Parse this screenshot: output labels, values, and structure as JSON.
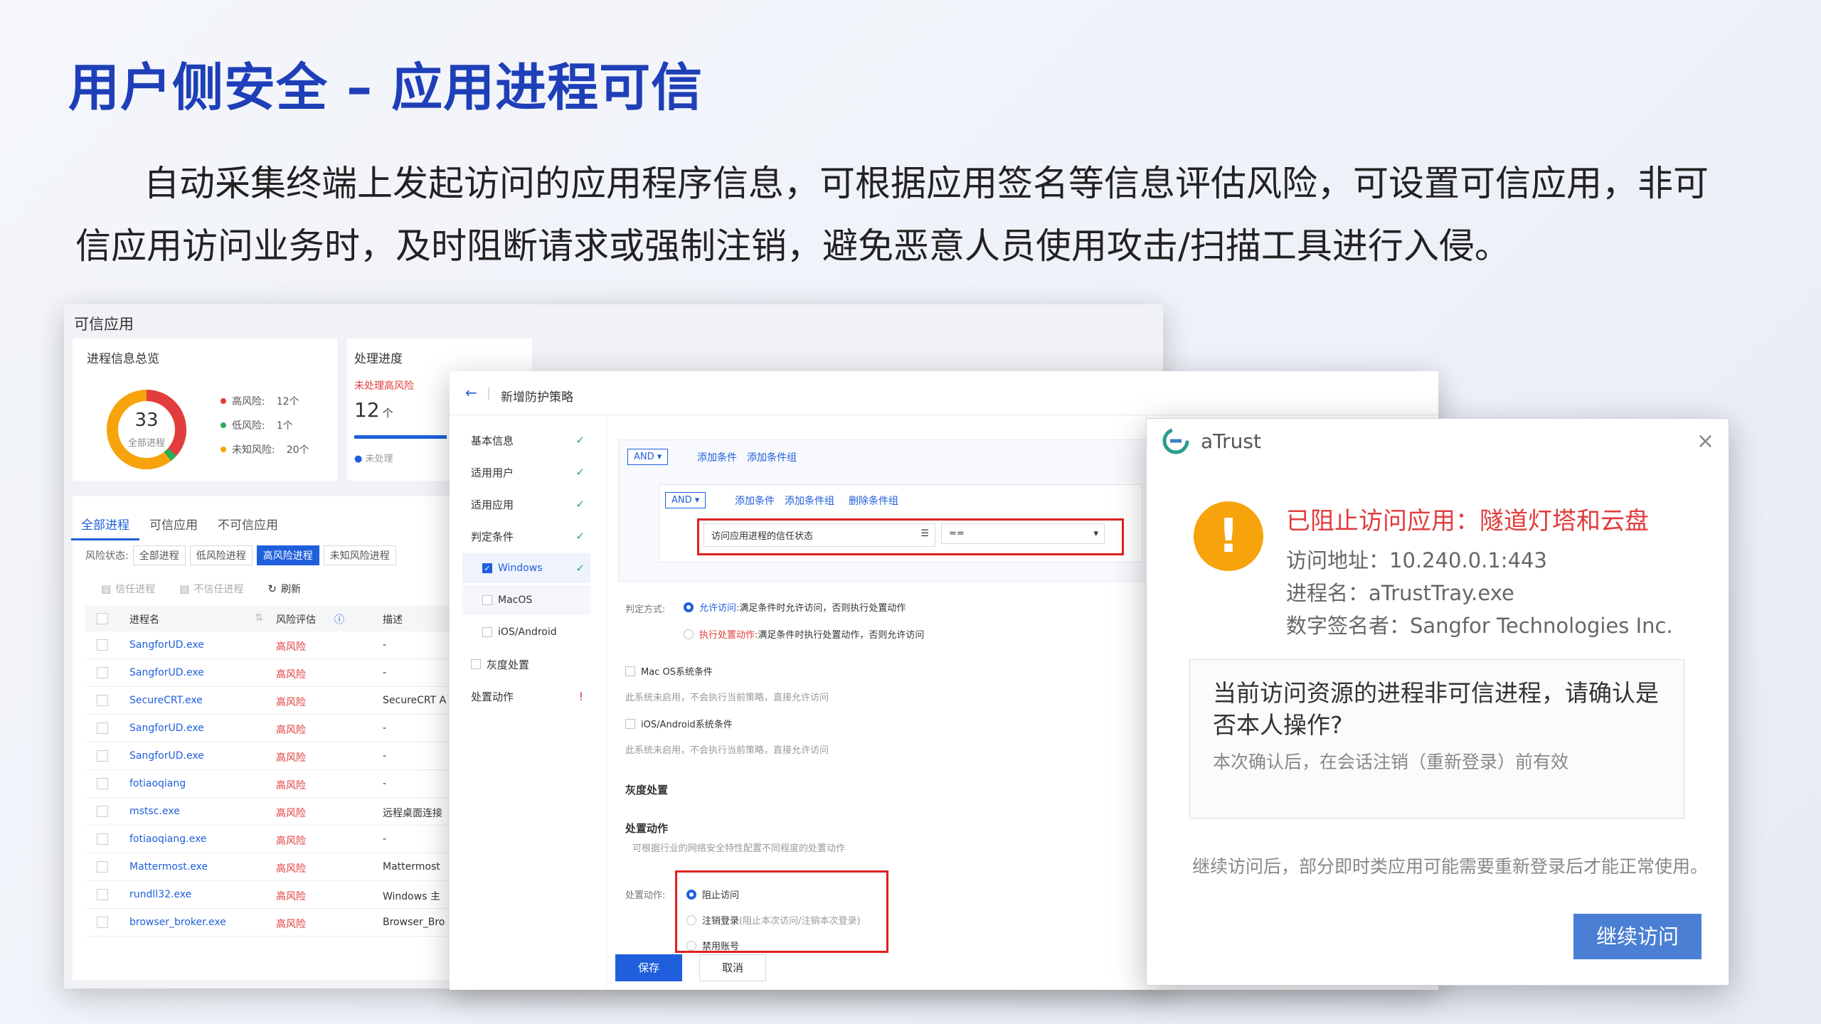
{
  "slide": {
    "title": "用户侧安全 – 应用进程可信",
    "desc": "自动采集终端上发起访问的应用程序信息，可根据应用签名等信息评估风险，可设置可信应用，非可信应用访问业务时，及时阻断请求或强制注销，避免恶意人员使用攻击/扫描工具进行入侵。"
  },
  "trusted_window": {
    "title": "可信应用",
    "overview": {
      "title": "进程信息总览",
      "total": "33",
      "total_label": "全部进程",
      "legend": [
        {
          "label": "高风险:",
          "value": "12个",
          "color": "#e23c3c"
        },
        {
          "label": "低风险:",
          "value": "1个",
          "color": "#2eaa5c"
        },
        {
          "label": "未知风险:",
          "value": "20个",
          "color": "#f7a30c"
        }
      ]
    },
    "progress": {
      "title": "处理进度",
      "unhandled_high_label": "未处理高风险",
      "count": "12",
      "unit": "个",
      "unhandled": "未处理"
    },
    "tabs": [
      "全部进程",
      "可信应用",
      "不可信应用"
    ],
    "filter_label": "风险状态:",
    "filters": [
      "全部进程",
      "低风险进程",
      "高风险进程",
      "未知风险进程"
    ],
    "actions": {
      "trust": "信任进程",
      "untrust": "不信任进程",
      "refresh": "刷新"
    },
    "columns": [
      "进程名",
      "风险评估",
      "描述"
    ],
    "rows": [
      {
        "name": "SangforUD.exe",
        "risk": "高风险",
        "desc": "-"
      },
      {
        "name": "SangforUD.exe",
        "risk": "高风险",
        "desc": "-"
      },
      {
        "name": "SecureCRT.exe",
        "risk": "高风险",
        "desc": "SecureCRT A"
      },
      {
        "name": "SangforUD.exe",
        "risk": "高风险",
        "desc": "-"
      },
      {
        "name": "SangforUD.exe",
        "risk": "高风险",
        "desc": "-"
      },
      {
        "name": "fotiaoqiang",
        "risk": "高风险",
        "desc": "-"
      },
      {
        "name": "mstsc.exe",
        "risk": "高风险",
        "desc": "远程桌面连接"
      },
      {
        "name": "fotiaoqiang.exe",
        "risk": "高风险",
        "desc": "-"
      },
      {
        "name": "Mattermost.exe",
        "risk": "高风险",
        "desc": "Mattermost"
      },
      {
        "name": "rundll32.exe",
        "risk": "高风险",
        "desc": "Windows 主"
      },
      {
        "name": "browser_broker.exe",
        "risk": "高风险",
        "desc": "Browser_Bro"
      }
    ]
  },
  "policy_window": {
    "title": "新增防护策略",
    "side": {
      "basic": "基本信息",
      "users": "适用用户",
      "apps": "适用应用",
      "conditions": "判定条件",
      "windows": "Windows",
      "macos": "MacOS",
      "ios": "iOS/Android",
      "gray": "灰度处置",
      "action": "处置动作"
    },
    "cond": {
      "and": "AND",
      "add_cond": "添加条件",
      "add_group": "添加条件组",
      "del_group": "删除条件组",
      "field": "访问应用进程的信任状态",
      "op": "=="
    },
    "judge_label": "判定方式:",
    "judge_allow": "允许访问:",
    "judge_allow_desc": "满足条件时允许访问，否则执行处置动作",
    "judge_exec": "执行处置动作:",
    "judge_exec_desc": "满足条件时执行处置动作，否则允许访问",
    "mac_cond": "Mac OS系统条件",
    "mac_hint": "此系统未启用，不会执行当前策略，直接允许访问",
    "ios_cond": "iOS/Android系统条件",
    "ios_hint": "此系统未启用，不会执行当前策略，直接允许访问",
    "gray_title": "灰度处置",
    "action_title": "处置动作",
    "action_hint": "可根据行业的网络安全特性配置不同程度的处置动作",
    "action_label": "处置动作:",
    "opt_block": "阻止访问",
    "opt_logout": "注销登录",
    "opt_logout_note": "(阻止本次访问/注销本次登录)",
    "opt_disable": "禁用账号",
    "save": "保存",
    "cancel": "取消"
  },
  "atrust": {
    "title": "aTrust",
    "blocked": "已阻止访问应用：隧道灯塔和云盘",
    "addr": "访问地址：10.240.0.1:443",
    "proc": "进程名：aTrustTray.exe",
    "signer": "数字签名者：Sangfor Technologies Inc.",
    "question": "当前访问资源的进程非可信进程，请确认是否本人操作?",
    "question_sub": "本次确认后，在会话注销（重新登录）前有效",
    "footnote": "继续访问后，部分即时类应用可能需要重新登录后才能正常使用。",
    "continue": "继续访问"
  }
}
